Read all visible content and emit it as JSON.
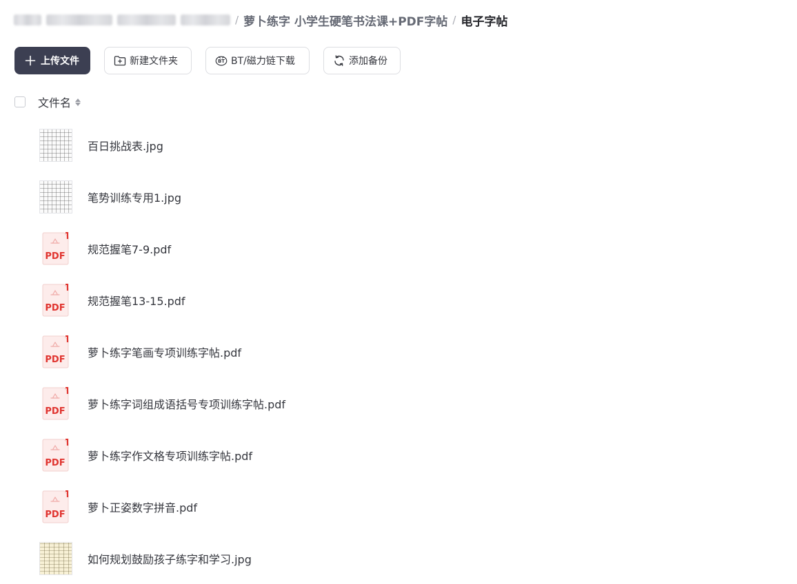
{
  "breadcrumb": {
    "items": [
      {
        "label": "萝卜练字 小学生硬笔书法课+PDF字帖"
      }
    ],
    "current": "电子字帖"
  },
  "toolbar": {
    "upload_label": "上传文件",
    "new_folder_label": "新建文件夹",
    "bt_download_label": "BT/磁力链下载",
    "add_backup_label": "添加备份"
  },
  "list_header": {
    "column_name": "文件名"
  },
  "files": [
    {
      "name": "百日挑战表.jpg",
      "type": "image",
      "icon": "image-thumbnail"
    },
    {
      "name": "笔势训练专用1.jpg",
      "type": "image",
      "icon": "image-thumbnail"
    },
    {
      "name": "规范握笔7-9.pdf",
      "type": "pdf",
      "icon": "pdf-file-icon"
    },
    {
      "name": "规范握笔13-15.pdf",
      "type": "pdf",
      "icon": "pdf-file-icon"
    },
    {
      "name": "萝卜练字笔画专项训练字帖.pdf",
      "type": "pdf",
      "icon": "pdf-file-icon"
    },
    {
      "name": "萝卜练字词组成语括号专项训练字帖.pdf",
      "type": "pdf",
      "icon": "pdf-file-icon"
    },
    {
      "name": "萝卜练字作文格专项训练字帖.pdf",
      "type": "pdf",
      "icon": "pdf-file-icon"
    },
    {
      "name": "萝卜正姿数字拼音.pdf",
      "type": "pdf",
      "icon": "pdf-file-icon"
    },
    {
      "name": "如何规划鼓励孩子练字和学习.jpg",
      "type": "image",
      "icon": "image-thumbnail"
    }
  ],
  "pdf_icon_text": "PDF",
  "bt_icon_text": "BT",
  "colors": {
    "primary_button": "#3c3f52",
    "pdf_red": "#e0342f",
    "pdf_bg": "#fdeceb"
  }
}
